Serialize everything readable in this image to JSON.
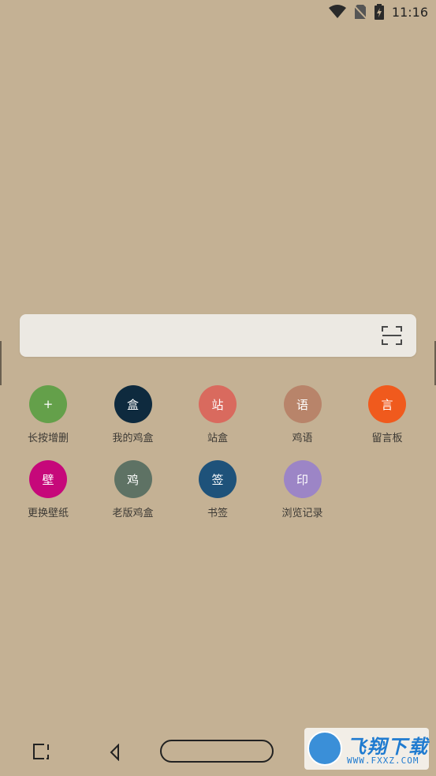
{
  "status_bar": {
    "time": "11:16",
    "icons": [
      "wifi-icon",
      "no-sim-icon",
      "battery-charging-icon"
    ]
  },
  "search": {
    "value": "",
    "placeholder": "",
    "scan_icon": "scan-icon"
  },
  "shortcuts": [
    {
      "icon_char": "+",
      "label": "长按增删",
      "color": "#64a04a"
    },
    {
      "icon_char": "盒",
      "label": "我的鸡盒",
      "color": "#0e2a3e"
    },
    {
      "icon_char": "站",
      "label": "站盒",
      "color": "#d96a5e"
    },
    {
      "icon_char": "语",
      "label": "鸡语",
      "color": "#b8846a"
    },
    {
      "icon_char": "言",
      "label": "留言板",
      "color": "#f05a1d"
    },
    {
      "icon_char": "壁",
      "label": "更换壁纸",
      "color": "#c6087a"
    },
    {
      "icon_char": "鸡",
      "label": "老版鸡盒",
      "color": "#5e7264"
    },
    {
      "icon_char": "签",
      "label": "书签",
      "color": "#1e527a"
    },
    {
      "icon_char": "印",
      "label": "浏览记录",
      "color": "#9c85c6"
    }
  ],
  "nav_bar": {
    "icons": [
      "recent-apps-icon",
      "back-icon",
      "home-pill"
    ]
  },
  "watermark": {
    "title": "飞翔下载",
    "url": "WWW.FXXZ.COM"
  }
}
